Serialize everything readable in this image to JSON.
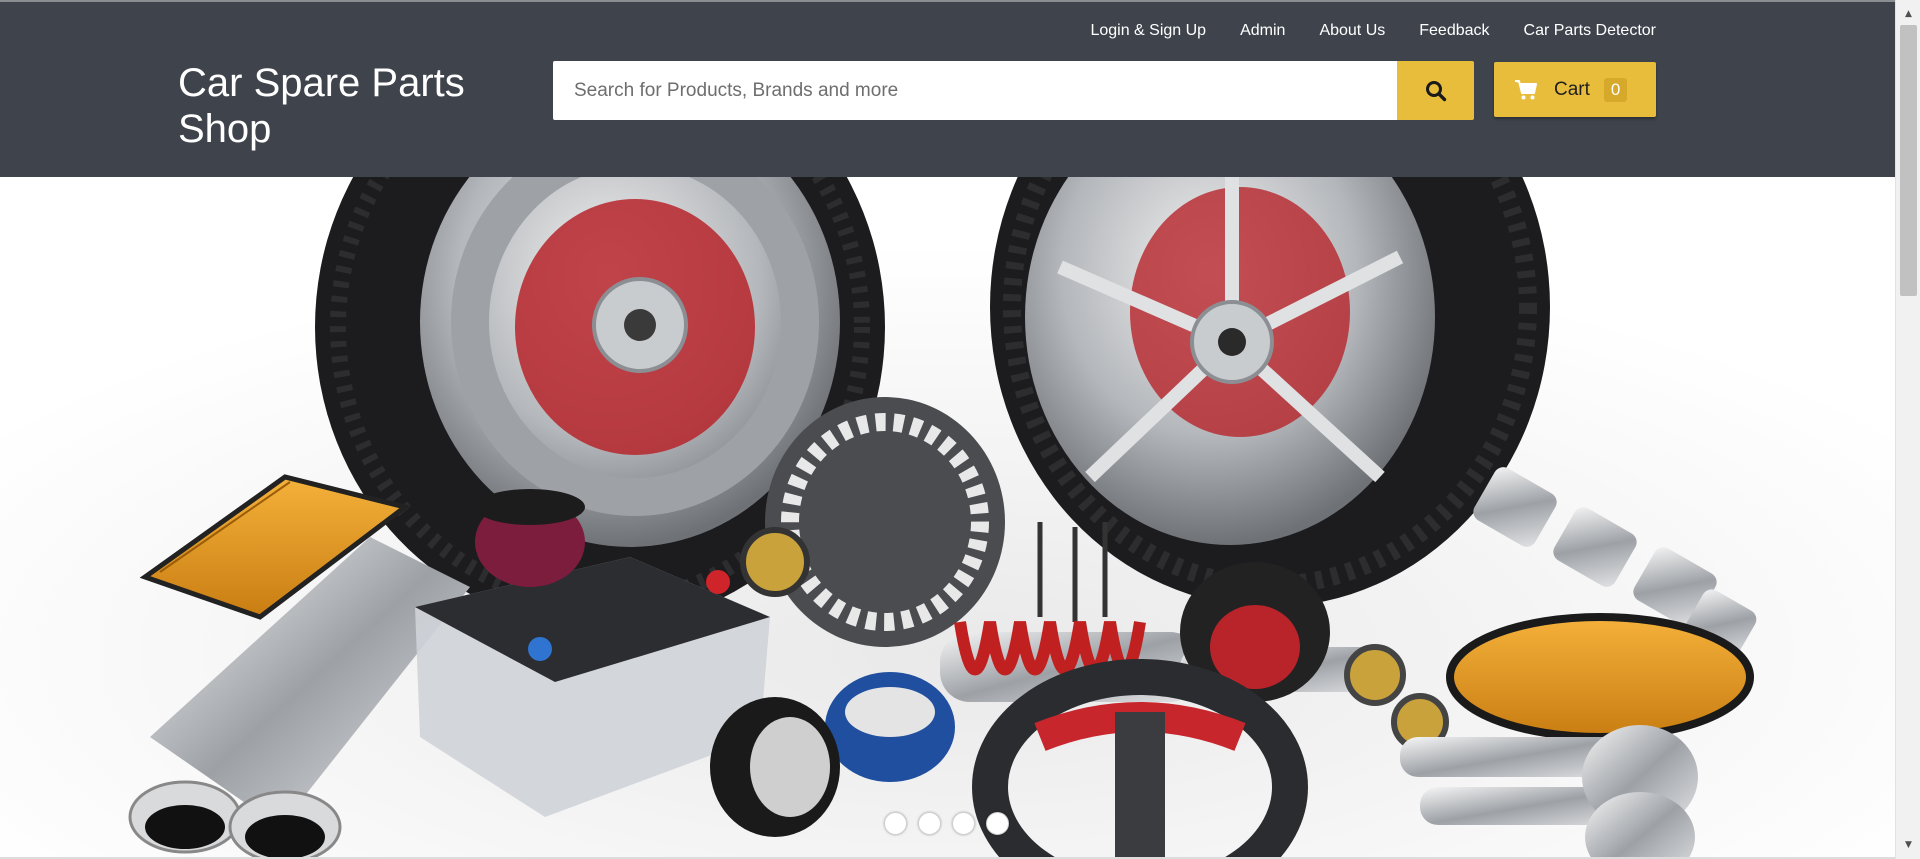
{
  "header": {
    "brand": "Car Spare Parts Shop",
    "nav": [
      {
        "label": "Login & Sign Up"
      },
      {
        "label": "Admin"
      },
      {
        "label": "About Us"
      },
      {
        "label": "Feedback"
      },
      {
        "label": "Car Parts Detector"
      }
    ],
    "search": {
      "placeholder": "Search for Products, Brands and more",
      "value": "",
      "button_icon": "search-icon"
    },
    "cart": {
      "label": "Cart",
      "count": "0",
      "icon": "cart-icon"
    }
  },
  "hero": {
    "image_subject": "car spare parts: wheels, tires, alternator, battery, shock absorber, exhaust, air filter, steering wheel, pistons",
    "slides": [
      {
        "active": true
      },
      {
        "active": false
      },
      {
        "active": false
      },
      {
        "active": false
      }
    ]
  },
  "colors": {
    "header_bg": "#3f444c",
    "accent": "#e8bd3c",
    "text_light": "#ffffff"
  }
}
